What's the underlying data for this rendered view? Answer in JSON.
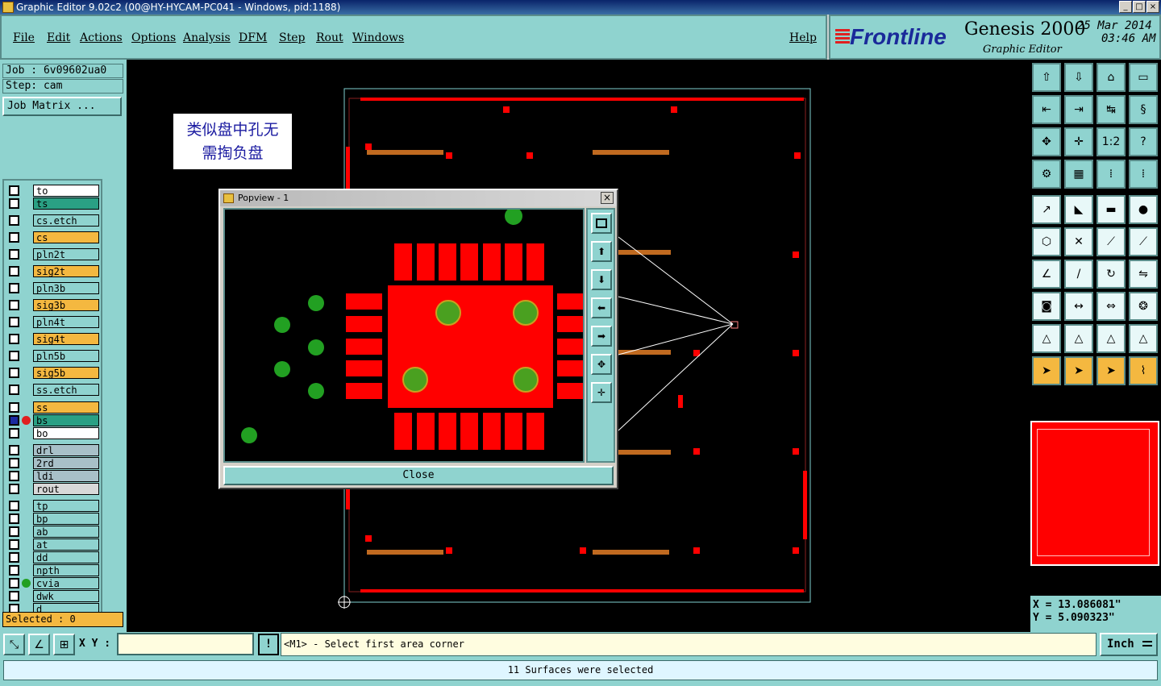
{
  "window": {
    "title": "Graphic Editor 9.02c2 (00@HY-HYCAM-PC041 - Windows, pid:1188)",
    "min": "_",
    "max": "□",
    "close": "×"
  },
  "menu": {
    "file": "File",
    "edit": "Edit",
    "actions": "Actions",
    "options": "Options",
    "analysis": "Analysis",
    "dfm": "DFM",
    "step": "Step",
    "rout": "Rout",
    "windows": "Windows",
    "help": "Help"
  },
  "brand": {
    "logo": "Frontline",
    "product": "Genesis 2000",
    "subtitle": "Graphic Editor",
    "date": "25 Mar 2014",
    "time": "03:46 AM"
  },
  "job": {
    "job_line": "Job : 6v09602ua0",
    "step_line": "Step: cam",
    "matrix_button": "Job Matrix ..."
  },
  "layers": [
    {
      "name": "to",
      "bg": "#ffffff",
      "mark": "◆"
    },
    {
      "name": "ts",
      "bg": "#2aa084",
      "mark": "◆"
    },
    {
      "name": "cs.etch",
      "bg": "#8fd3cf",
      "mark": ""
    },
    {
      "name": "cs",
      "bg": "#f4b840",
      "mark": "◆"
    },
    {
      "name": "pln2t",
      "bg": "#8fd3cf",
      "mark": ""
    },
    {
      "name": "sig2t",
      "bg": "#f4b840",
      "mark": "◆"
    },
    {
      "name": "pln3b",
      "bg": "#8fd3cf",
      "mark": ""
    },
    {
      "name": "sig3b",
      "bg": "#f4b840",
      "mark": "◆"
    },
    {
      "name": "pln4t",
      "bg": "#8fd3cf",
      "mark": ""
    },
    {
      "name": "sig4t",
      "bg": "#f4b840",
      "mark": "◆"
    },
    {
      "name": "pln5b",
      "bg": "#8fd3cf",
      "mark": ""
    },
    {
      "name": "sig5b",
      "bg": "#f4b840",
      "mark": "◆"
    },
    {
      "name": "ss.etch",
      "bg": "#8fd3cf",
      "mark": ""
    },
    {
      "name": "ss",
      "bg": "#f4b840",
      "mark": "◆"
    },
    {
      "name": "bs",
      "bg": "#2aa084",
      "mark": "◆"
    },
    {
      "name": "bo",
      "bg": "#ffffff",
      "mark": "◆"
    },
    {
      "name": "drl",
      "bg": "#a8c0c8",
      "mark": ""
    },
    {
      "name": "2rd",
      "bg": "#a8c0c8",
      "mark": ""
    },
    {
      "name": "ldi",
      "bg": "#a8c0c8",
      "mark": ""
    },
    {
      "name": "rout",
      "bg": "#d8d8d8",
      "mark": ""
    },
    {
      "name": "tp",
      "bg": "#8fd3cf",
      "mark": "◆"
    },
    {
      "name": "bp",
      "bg": "#8fd3cf",
      "mark": "◆"
    },
    {
      "name": "ab",
      "bg": "#8fd3cf",
      "mark": "◆"
    },
    {
      "name": "at",
      "bg": "#8fd3cf",
      "mark": "◆"
    },
    {
      "name": "dd",
      "bg": "#8fd3cf",
      "mark": "◆"
    },
    {
      "name": "npth",
      "bg": "#8fd3cf",
      "mark": ""
    },
    {
      "name": "cvia",
      "bg": "#8fd3cf",
      "mark": ""
    },
    {
      "name": "dwk",
      "bg": "#8fd3cf",
      "mark": ""
    },
    {
      "name": "d",
      "bg": "#8fd3cf",
      "mark": ""
    }
  ],
  "selected": "Selected : 0",
  "annotation": {
    "line1": "类似盘中孔无",
    "line2": "需掏负盘"
  },
  "popup": {
    "title": "Popview - 1",
    "close_label": "Close",
    "close_x": "×"
  },
  "coords": {
    "x": "X = 13.086081\"",
    "y": "Y = 5.090323\""
  },
  "bottom": {
    "xy_label": "X Y :",
    "xy_value": "",
    "bang": "!",
    "prompt": "<M1> - Select first area corner",
    "units": "Inch"
  },
  "status": "11 Surfaces were selected",
  "colors": {
    "panel": "#8fd3cf",
    "canvas": "#000000",
    "copper": "#ff0000",
    "via": "#22a022"
  }
}
